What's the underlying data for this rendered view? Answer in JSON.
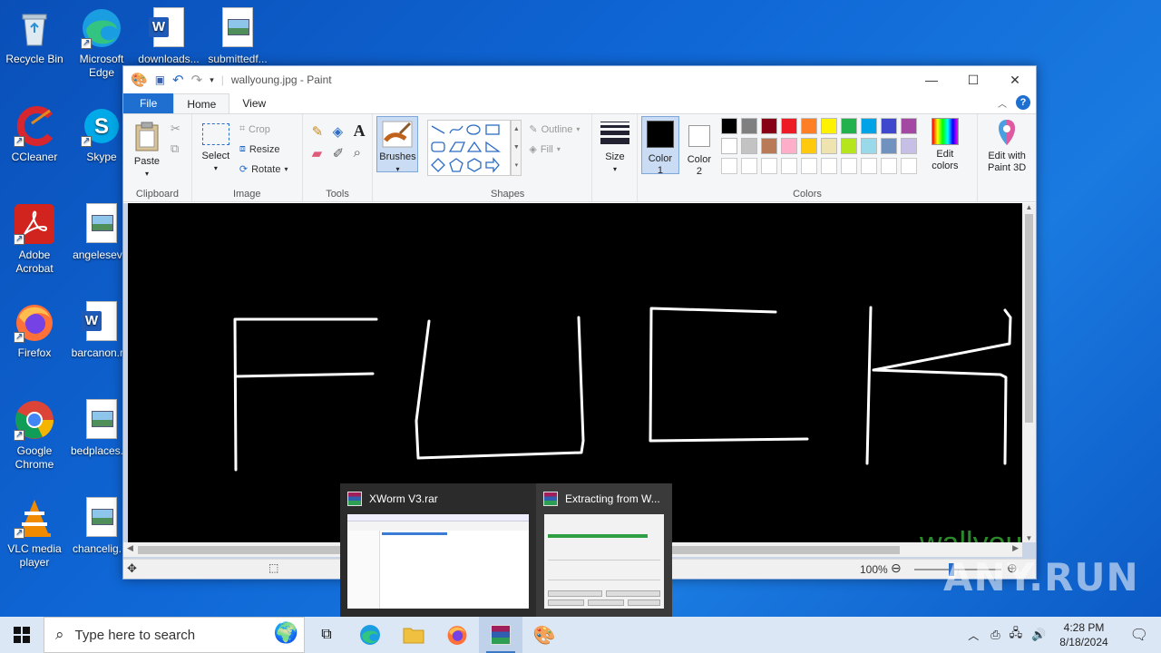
{
  "desktop": {
    "icons": [
      {
        "label": "Recycle Bin"
      },
      {
        "label": "Microsoft Edge"
      },
      {
        "label": "downloads..."
      },
      {
        "label": "submittedf..."
      },
      {
        "label": "CCleaner"
      },
      {
        "label": "Skype"
      },
      {
        "label": "Adobe Acrobat"
      },
      {
        "label": "angelesev..."
      },
      {
        "label": "Firefox"
      },
      {
        "label": "barcanon.r..."
      },
      {
        "label": "Google Chrome"
      },
      {
        "label": "bedplaces...."
      },
      {
        "label": "VLC media player"
      },
      {
        "label": "chancelig...."
      }
    ]
  },
  "paint": {
    "title": "wallyoung.jpg - Paint",
    "tabs": {
      "file": "File",
      "home": "Home",
      "view": "View"
    },
    "clipboard": {
      "paste": "Paste",
      "group": "Clipboard"
    },
    "image": {
      "select": "Select",
      "crop": "Crop",
      "resize": "Resize",
      "rotate": "Rotate",
      "group": "Image"
    },
    "tools": {
      "group": "Tools",
      "text_glyph": "A"
    },
    "brushes": {
      "label": "Brushes"
    },
    "shapes": {
      "outline": "Outline",
      "fill": "Fill",
      "group": "Shapes"
    },
    "size": {
      "label": "Size"
    },
    "colors": {
      "color1": "Color 1",
      "color2": "Color 2",
      "edit": "Edit colors",
      "group": "Colors",
      "color1_value": "#000000",
      "color2_value": "#ffffff",
      "palette_row1": [
        "#000000",
        "#7f7f7f",
        "#880015",
        "#ed1c24",
        "#ff7f27",
        "#fff200",
        "#22b14c",
        "#00a2e8",
        "#3f48cc",
        "#a349a4"
      ],
      "palette_row2": [
        "#ffffff",
        "#c3c3c3",
        "#b97a57",
        "#ffaec9",
        "#ffc90e",
        "#efe4b0",
        "#b5e61d",
        "#99d9ea",
        "#7092be",
        "#c8bfe7"
      ]
    },
    "paint3d": {
      "label": "Edit with Paint 3D"
    },
    "canvas": {
      "overlay_text": "wallyou"
    },
    "status": {
      "zoom": "100%"
    }
  },
  "taskbar_preview": {
    "items": [
      {
        "title": "XWorm V3.rar"
      },
      {
        "title": "Extracting from W..."
      }
    ]
  },
  "taskbar": {
    "search_placeholder": "Type here to search",
    "time": "4:28 PM",
    "date": "8/18/2024"
  },
  "watermark": "ANY.RUN"
}
